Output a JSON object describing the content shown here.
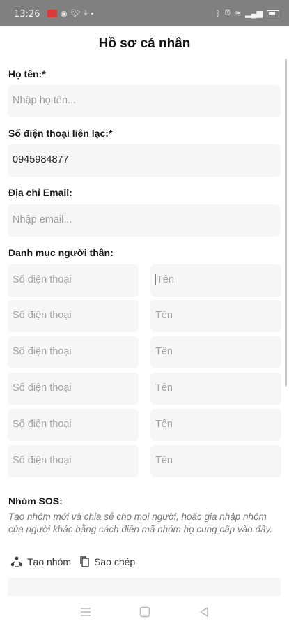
{
  "status_bar": {
    "time": "13:26"
  },
  "header": {
    "title": "Hồ sơ cá nhân"
  },
  "form": {
    "name_label": "Họ tên:*",
    "name_placeholder": "Nhập họ tên...",
    "phone_label": "Số điện thoại liên lạc:*",
    "phone_value": "0945984877",
    "email_label": "Địa chỉ Email:",
    "email_placeholder": "Nhập email...",
    "relatives_label": "Danh mục người thân:",
    "relatives": [
      {
        "phone_placeholder": "Số điện thoại",
        "name_placeholder": "Tên"
      },
      {
        "phone_placeholder": "Số điện thoại",
        "name_placeholder": "Tên"
      },
      {
        "phone_placeholder": "Số điện thoại",
        "name_placeholder": "Tên"
      },
      {
        "phone_placeholder": "Số điện thoại",
        "name_placeholder": "Tên"
      },
      {
        "phone_placeholder": "Số điện thoại",
        "name_placeholder": "Tên"
      },
      {
        "phone_placeholder": "Số điện thoại",
        "name_placeholder": "Tên"
      }
    ]
  },
  "sos": {
    "label": "Nhóm SOS:",
    "description": "Tạo nhóm mới và chia sẻ cho mọi người, hoặc gia nhập nhóm của người khác bằng cách điền mã nhóm họ cung cấp vào đây.",
    "create_label": "Tạo nhóm",
    "copy_label": "Sao chép"
  }
}
